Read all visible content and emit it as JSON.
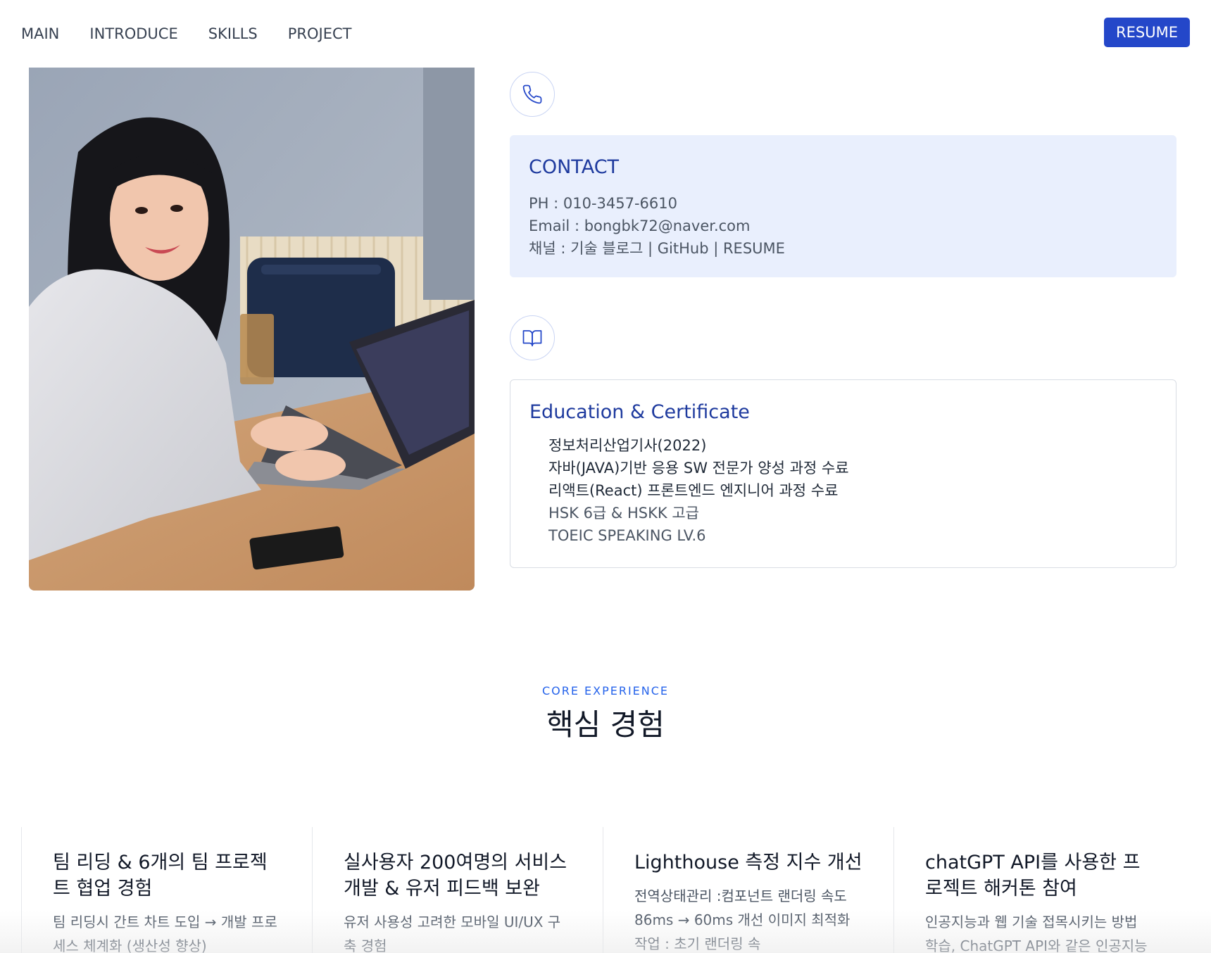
{
  "nav": {
    "links": [
      "MAIN",
      "INTRODUCE",
      "SKILLS",
      "PROJECT"
    ],
    "resume_label": "RESUME"
  },
  "icons": {
    "contact": "phone-icon",
    "education": "book-icon"
  },
  "contact": {
    "title": "CONTACT",
    "phone": "PH : 010-3457-6610",
    "email": "Email : bongbk72@naver.com",
    "channels": "채널 : 기술 블로그 | GitHub | RESUME"
  },
  "education": {
    "title": "Education & Certificate",
    "items": [
      "정보처리산업기사(2022)",
      "자바(JAVA)기반 응용 SW 전문가 양성 과정 수료",
      "리액트(React) 프론트엔드 엔지니어 과정 수료",
      "HSK 6급 & HSKK 고급",
      "TOEIC SPEAKING LV.6"
    ]
  },
  "core": {
    "eyebrow": "CORE EXPERIENCE",
    "title": "핵심 경험",
    "cards": [
      {
        "title": "팀 리딩 & 6개의 팀 프로젝트 협업 경험",
        "desc": "팀 리딩시 간트 차트 도입 → 개발 프로세스 체계화 (생산성 향상)"
      },
      {
        "title": "실사용자 200여명의 서비스 개발 & 유저 피드백 보완",
        "desc": "유저 사용성 고려한 모바일 UI/UX 구축 경험"
      },
      {
        "title": "Lighthouse 측정 지수 개선",
        "desc": "전역상태관리 :컴포넌트 랜더링 속도 86ms → 60ms 개선 이미지 최적화 작업 : 초기 랜더링 속"
      },
      {
        "title": "chatGPT API를 사용한 프로젝트 해커톤 참여",
        "desc": "인공지능과 웹 기술 접목시키는 방법 학습, ChatGPT API와 같은 인공지능"
      }
    ]
  },
  "colors": {
    "accent": "#2447c9",
    "contact_bg": "#e9effd",
    "heading_blue": "#1e3a9e"
  }
}
